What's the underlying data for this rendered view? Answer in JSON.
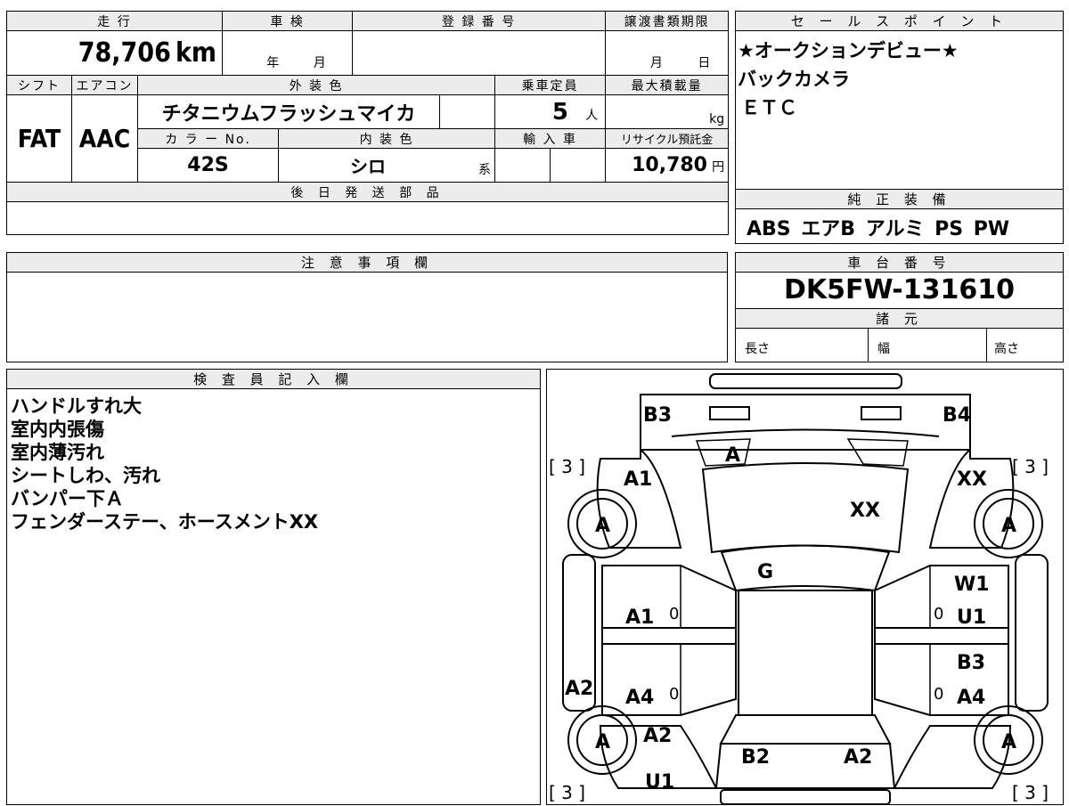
{
  "top_table": {
    "h_mileage": "走 行",
    "h_shaken": "車 検",
    "h_reg": "登 録 番 号",
    "h_transfer": "譲渡書類期限",
    "mileage": "78,706",
    "mileage_unit": "km",
    "shaken_year": "年",
    "shaken_month": "月",
    "transfer_month": "月",
    "transfer_day": "日",
    "h_shift": "シフト",
    "h_ac": "エアコン",
    "h_exterior": "外 装 色",
    "h_capacity": "乗車定員",
    "h_maxload": "最大積載量",
    "shift": "FAT",
    "ac": "AAC",
    "exterior_color": "チタニウムフラッシュマイカ",
    "capacity": "5",
    "capacity_unit": "人",
    "load_unit": "kg",
    "h_color_no": "カ ラ ー No.",
    "h_interior": "内 装 色",
    "h_import": "輸 入 車",
    "h_recycle": "リサイクル預託金",
    "color_no": "42S",
    "interior_color": "シロ",
    "interior_suffix": "系",
    "recycle_fee": "10,780",
    "recycle_unit": "円",
    "h_later_parts": "後 日 発 送 部 品"
  },
  "sales_points": {
    "header": "セ ー ル ス ポ イ ン ト",
    "lines": [
      "★オークションデビュー★",
      "バックカメラ",
      "ＥＴＣ"
    ]
  },
  "equipment": {
    "header": "純 正 装 備",
    "value": "ABS エアB アルミ PS PW"
  },
  "notes": {
    "header": "注 意 事 項 欄"
  },
  "chassis": {
    "header": "車 台 番 号",
    "number": "DK5FW-131610",
    "specs_header": "諸 元",
    "length": "長さ",
    "width": "幅",
    "height": "高さ"
  },
  "inspector": {
    "header": "検 査 員 記 入 欄",
    "lines": [
      "ハンドルすれ大",
      "室内内張傷",
      "室内薄汚れ",
      "シートしわ、汚れ",
      "バンパー下Ａ",
      "フェンダーステー、ホースメントXX"
    ]
  },
  "diagram": {
    "B3": "B3",
    "B4": "B4",
    "A_front": "A",
    "tire_fl_bracket": "[ 3 ]",
    "tire_fr_bracket": "[ 3 ]",
    "A1_front_left": "A1",
    "XX_front_right": "XX",
    "XX_hood": "XX",
    "A_tire_fl": "A",
    "A_tire_fr": "A",
    "G_windshield": "G",
    "A1_door_fl": "A1",
    "zero_fl": "0",
    "W1_right": "W1",
    "U1_door_fr": "U1",
    "zero_fr": "0",
    "B3_door_rr": "B3",
    "A2_sill_left": "A2",
    "A4_door_rl": "A4",
    "zero_rl": "0",
    "A4_door_rr": "A4",
    "zero_rr": "0",
    "A_tire_rl": "A",
    "A_tire_rr": "A",
    "A2_rear_left_fender": "A2",
    "B2_rear": "B2",
    "A2_rear": "A2",
    "U1_rear": "U1",
    "tire_rl_bracket": "[ 3 ]",
    "tire_rr_bracket": "[ 3 ]"
  }
}
